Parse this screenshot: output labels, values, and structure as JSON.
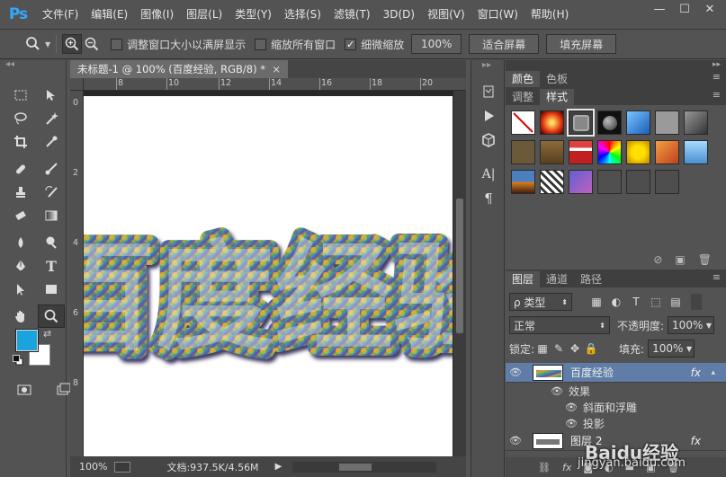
{
  "app": {
    "logo": "Ps"
  },
  "menubar": {
    "items": [
      "文件(F)",
      "编辑(E)",
      "图像(I)",
      "图层(L)",
      "类型(Y)",
      "选择(S)",
      "滤镜(T)",
      "3D(D)",
      "视图(V)",
      "窗口(W)",
      "帮助(H)"
    ],
    "window_controls": {
      "minimize": "—",
      "restore": "☐",
      "close": "✕"
    }
  },
  "options": {
    "resize_windows_label": "调整窗口大小以满屏显示",
    "resize_windows_checked": false,
    "zoom_all_label": "缩放所有窗口",
    "zoom_all_checked": false,
    "scrubby_zoom_label": "细微缩放",
    "scrubby_zoom_checked": true,
    "btn_100": "100%",
    "btn_fit": "适合屏幕",
    "btn_fill": "填充屏幕"
  },
  "colors": {
    "foreground": "#1aa3dc",
    "background": "#ffffff",
    "accent": "#31a8ff",
    "selected_layer": "#5f7da6"
  },
  "document": {
    "tab_title": "未标题-1 @ 100% (百度经验, RGB/8) *",
    "close": "×",
    "canvas_text": "百度经验",
    "ruler_top": [
      "8",
      "10",
      "12",
      "14",
      "16",
      "18",
      "20"
    ],
    "ruler_left": [
      "0",
      "2",
      "4",
      "6",
      "8"
    ]
  },
  "status": {
    "zoom": "100%",
    "doc_info": "文档:937.5K/4.56M",
    "arrow": "▶"
  },
  "panels": {
    "color_tabs": [
      "颜色",
      "色板"
    ],
    "style_tabs": [
      "调整",
      "样式"
    ],
    "layer_tabs": [
      "图层",
      "通道",
      "路径"
    ],
    "menu_icon": "≡"
  },
  "layers": {
    "filter_label": "ρ 类型",
    "blend_mode": "正常",
    "opacity_label": "不透明度:",
    "opacity_value": "100%",
    "lock_label": "锁定:",
    "fill_label": "填充:",
    "fill_value": "100%",
    "items": [
      {
        "name": "百度经验",
        "fx": "fx"
      },
      {
        "name": "图层 2",
        "fx": "fx"
      }
    ],
    "effects_label": "效果",
    "effect_1": "斜面和浮雕",
    "effect_2": "投影"
  },
  "watermark": {
    "text": "Baidu经验",
    "url": "jingyan.baidu.com"
  }
}
